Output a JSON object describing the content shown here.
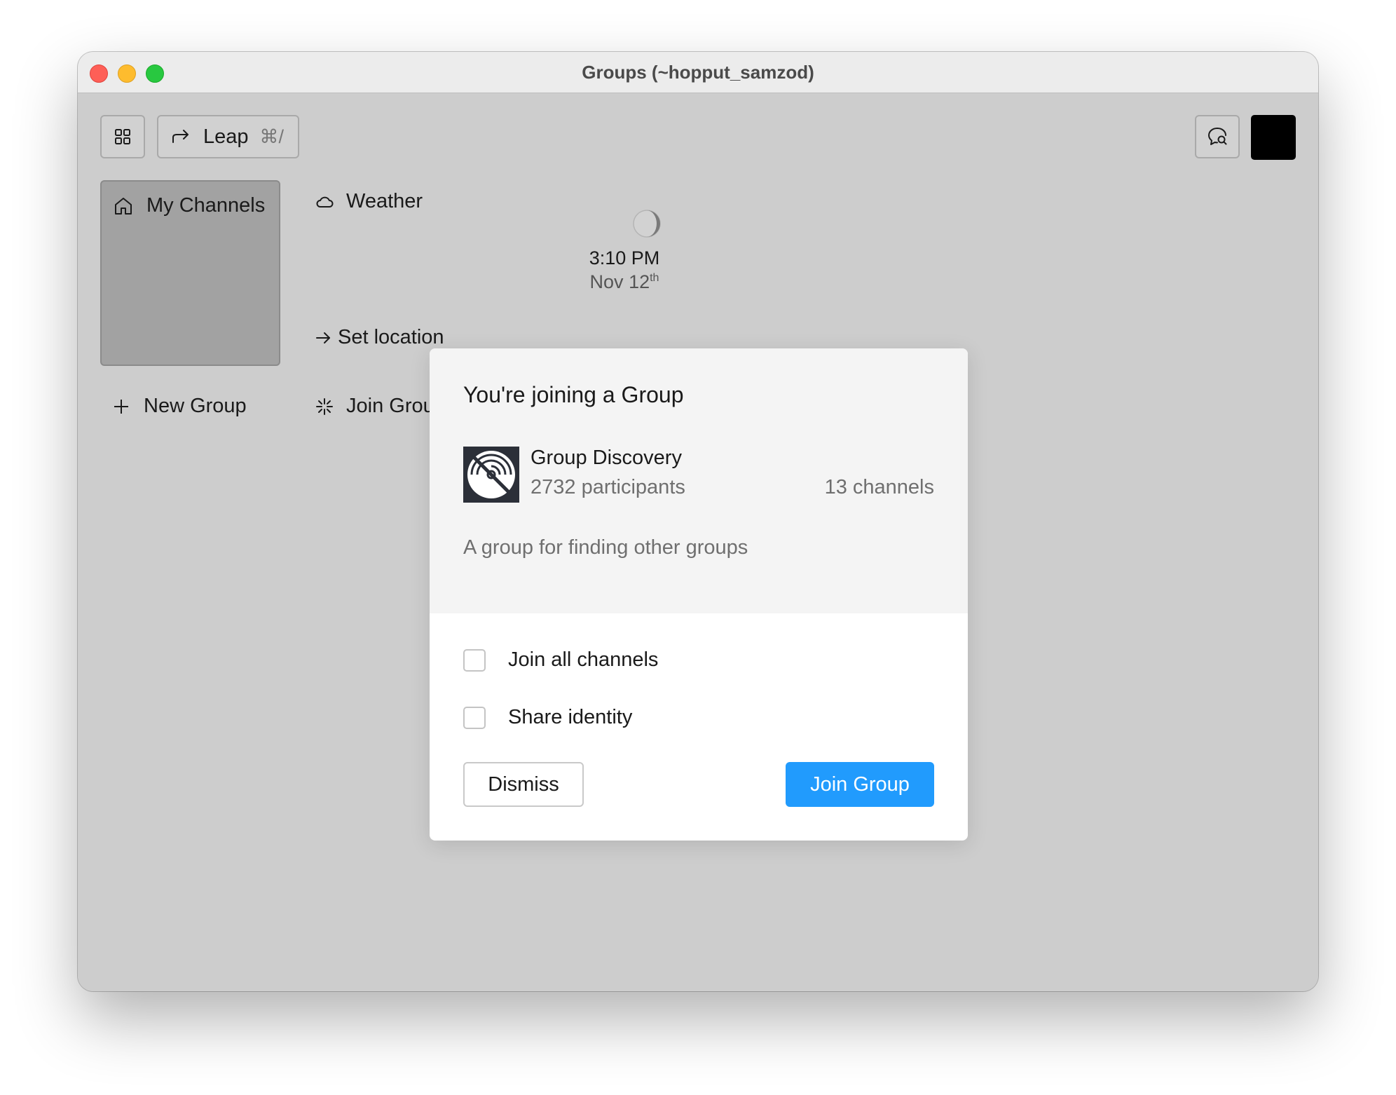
{
  "window": {
    "title": "Groups (~hopput_samzod)"
  },
  "toolbar": {
    "grid_icon": "grid-icon",
    "leap_label": "Leap",
    "leap_shortcut": "⌘/",
    "messages_icon": "chat-search-icon"
  },
  "sidebar": {
    "my_channels": "My Channels",
    "new_group": "New Group"
  },
  "tiles": {
    "weather": "Weather",
    "set_location": "Set location",
    "join_group": "Join Group",
    "clock": {
      "time": "3:10 PM",
      "date": "Nov 12",
      "date_suffix": "th"
    }
  },
  "modal": {
    "title": "You're joining a Group",
    "group": {
      "name": "Group Discovery",
      "participants": "2732 participants",
      "channels": "13 channels",
      "description": "A group for finding other groups"
    },
    "options": [
      "Join all channels",
      "Share identity"
    ],
    "dismiss": "Dismiss",
    "join": "Join Group"
  },
  "colors": {
    "accent": "#219bfd",
    "backdrop": "#cdcdcd",
    "selected_tile": "#a2a2a2"
  }
}
